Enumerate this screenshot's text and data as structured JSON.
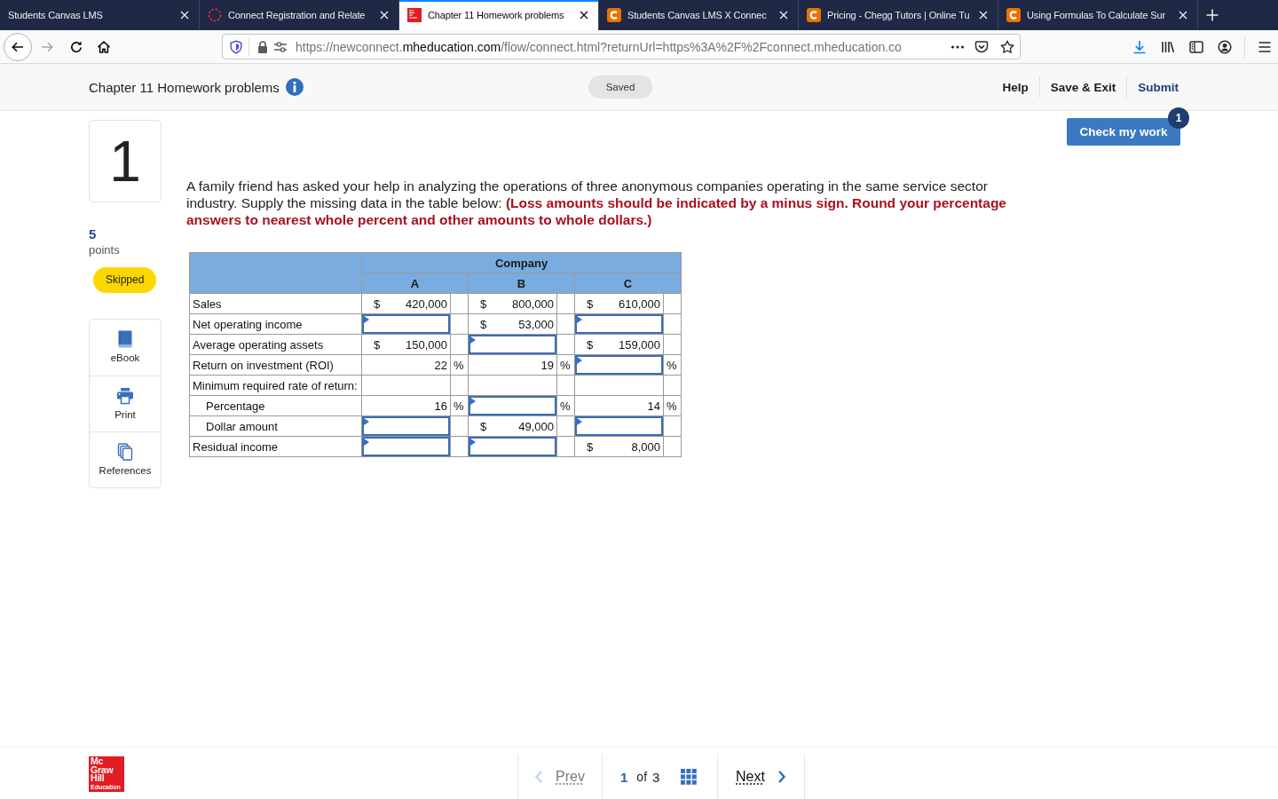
{
  "browser_tabs": [
    {
      "title": "Students Canvas LMS",
      "kind": "plain",
      "selected": false
    },
    {
      "title": "Connect Registration and Relate",
      "kind": "loading",
      "selected": false
    },
    {
      "title": "Chapter 11 Homework problems",
      "kind": "logo",
      "selected": true
    },
    {
      "title": "Students Canvas LMS X Connec",
      "kind": "letter",
      "selected": false
    },
    {
      "title": "Pricing - Chegg Tutors | Online Tu",
      "kind": "letter",
      "selected": false
    },
    {
      "title": "Using Formulas To Calculate Sur",
      "kind": "letter",
      "selected": false
    }
  ],
  "toolbar": {
    "forward_disabled": true,
    "url": {
      "start": "https://newconnect.",
      "domain": "mheducation.com",
      "rest": "/flow/connect.html?returnUrl=https%3A%2F%2Fconnect.mheducation.co"
    }
  },
  "assignment_header": {
    "title": "Chapter 11 Homework problems",
    "save_state": "Saved",
    "links": [
      {
        "label": "Help",
        "kind": "plain"
      },
      {
        "label": "Save & Exit",
        "kind": "plain"
      },
      {
        "label": "Submit",
        "kind": "primary"
      }
    ]
  },
  "check_my_work": {
    "label": "Check my work",
    "badge": "1"
  },
  "question": {
    "number": "1",
    "points": "5",
    "points_label": "points",
    "status": "Skipped",
    "tools": [
      {
        "label": "eBook",
        "kind": "book"
      },
      {
        "label": "Print",
        "kind": "printer"
      },
      {
        "label": "References",
        "kind": "pages"
      }
    ],
    "prompt": "A family friend has asked your help in analyzing the operations of three anonymous companies operating in the same service sector industry. Supply the missing data in the table below: **(Loss amounts should be indicated by a minus sign. Round your percentage answers to nearest whole percent and other amounts to whole dollars.)**"
  },
  "table": {
    "group_header": "Company",
    "columns": [
      "A",
      "B",
      "C"
    ],
    "rows": [
      {
        "label": "Sales",
        "cells": [
          {
            "kind": "amount",
            "prefix": "$",
            "value": "420,000"
          },
          {
            "kind": "amount",
            "prefix": "$",
            "value": "800,000"
          },
          {
            "kind": "amount",
            "prefix": "$",
            "value": "610,000"
          }
        ]
      },
      {
        "label": "Net operating income",
        "cells": [
          {
            "kind": "input"
          },
          {
            "kind": "amount",
            "prefix": "$",
            "value": "53,000"
          },
          {
            "kind": "input"
          }
        ]
      },
      {
        "label": "Average operating assets",
        "cells": [
          {
            "kind": "amount",
            "prefix": "$",
            "value": "150,000"
          },
          {
            "kind": "input"
          },
          {
            "kind": "amount",
            "prefix": "$",
            "value": "159,000"
          }
        ]
      },
      {
        "label": "Return on investment (ROI)",
        "cells": [
          {
            "kind": "amount",
            "value": "22",
            "suffix": "%"
          },
          {
            "kind": "amount",
            "value": "19",
            "suffix": "%"
          },
          {
            "kind": "input",
            "suffix": "%"
          }
        ]
      },
      {
        "label": "Minimum required rate of return:",
        "cells": [
          {
            "kind": "blank"
          },
          {
            "kind": "blank"
          },
          {
            "kind": "blank"
          }
        ],
        "children": [
          {
            "label": "Percentage",
            "cells": [
              {
                "kind": "amount",
                "value": "16",
                "suffix": "%"
              },
              {
                "kind": "input",
                "suffix": "%"
              },
              {
                "kind": "amount",
                "value": "14",
                "suffix": "%"
              }
            ]
          },
          {
            "label": "Dollar amount",
            "cells": [
              {
                "kind": "input"
              },
              {
                "kind": "amount",
                "prefix": "$",
                "value": "49,000"
              },
              {
                "kind": "input"
              }
            ]
          }
        ]
      },
      {
        "label": "Residual income",
        "cells": [
          {
            "kind": "input"
          },
          {
            "kind": "input"
          },
          {
            "kind": "amount",
            "prefix": "$",
            "value": "8,000"
          }
        ]
      }
    ]
  },
  "footer": {
    "logo_lines": [
      "Mc",
      "Graw",
      "Hill",
      "Education"
    ],
    "pagination": {
      "prev": {
        "label": "Prev",
        "disabled": true
      },
      "current": "1",
      "of": "of",
      "total": "3",
      "next": {
        "label": "Next",
        "disabled": false
      }
    }
  }
}
